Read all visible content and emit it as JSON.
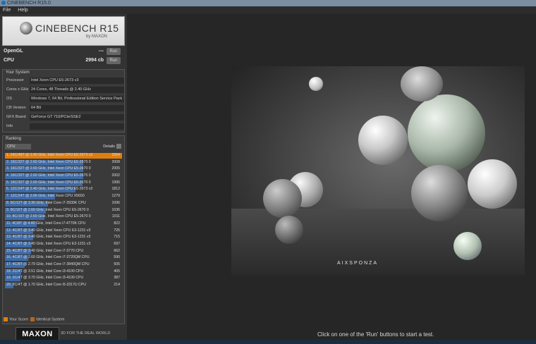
{
  "window": {
    "title": "CINEBENCH R15.0"
  },
  "menu": [
    "File",
    "Help"
  ],
  "logo": {
    "title": "CINEBENCH R15",
    "sub": "by MAXON"
  },
  "scores": {
    "opengl": {
      "label": "OpenGL",
      "value": "---",
      "run": "Run"
    },
    "cpu": {
      "label": "CPU",
      "value": "2994 cb",
      "run": "Run"
    }
  },
  "system": {
    "title": "Your System",
    "rows": [
      {
        "k": "Processor",
        "v": "Intel Xeon CPU E5-2673 v3"
      },
      {
        "k": "Cores x GHz",
        "v": "24 Cores, 48 Threads @ 2.40 GHz"
      },
      {
        "k": "OS",
        "v": "Windows 7, 64 Bit, Professional Edition Service Pack 1"
      },
      {
        "k": "CB Version",
        "v": "64 Bit"
      },
      {
        "k": "GFX Board",
        "v": "GeForce GT 710/PCIe/SSE2"
      },
      {
        "k": "Info",
        "v": ""
      }
    ]
  },
  "ranking": {
    "title": "Ranking",
    "select": "CPU",
    "details": "Details",
    "rows": [
      {
        "label": "1. 24C/48T @ 2.40 GHz, Intel Xeon CPU E5-2673 v3",
        "score": "2994",
        "pct": 1.0
      },
      {
        "label": "2. 16C/32T @ 2.60 GHz, Intel Xeon CPU E5-2670 0",
        "score": "2008",
        "pct": 0.67
      },
      {
        "label": "3. 16C/32T @ 2.60 GHz, Intel Xeon CPU E5-2670 0",
        "score": "2005",
        "pct": 0.67
      },
      {
        "label": "4. 16C/32T @ 2.60 GHz, Intel Xeon CPU E5-2670 0",
        "score": "2002",
        "pct": 0.67
      },
      {
        "label": "5. 16C/32T @ 2.60 GHz, Intel Xeon CPU E5-2670 0",
        "score": "1995",
        "pct": 0.66
      },
      {
        "label": "6. 12C/24T @ 2.40 GHz, Intel Xeon CPU E5-2673 v3",
        "score": "1812",
        "pct": 0.6
      },
      {
        "label": "7. 12C/24T @ 2.66 GHz, Intel Xeon CPU X5650",
        "score": "1279",
        "pct": 0.43
      },
      {
        "label": "8. 6C/12T @ 3.30 GHz, Intel Core i7-3930K CPU",
        "score": "1096",
        "pct": 0.37
      },
      {
        "label": "9. 8C/16T @ 2.60 GHz, Intel Xeon CPU E5-2670 0",
        "score": "1036",
        "pct": 0.35
      },
      {
        "label": "10. 8C/16T @ 2.60 GHz, Intel Xeon CPU E5-2670 0",
        "score": "1011",
        "pct": 0.34
      },
      {
        "label": "11. 4C/8T @ 4.40 GHz, Intel Core i7-4770K CPU",
        "score": "822",
        "pct": 0.27
      },
      {
        "label": "12. 4C/8T @ 3.40 GHz, Intel Xeon CPU E3-1231 v3",
        "score": "725",
        "pct": 0.24
      },
      {
        "label": "13. 4C/8T @ 3.40 GHz, Intel Xeon CPU E3-1231 v3",
        "score": "715",
        "pct": 0.24
      },
      {
        "label": "14. 4C/8T @ 3.40 GHz, Intel Xeon CPU E3-1231 v3",
        "score": "697",
        "pct": 0.23
      },
      {
        "label": "15. 4C/8T @ 3.40 GHz, Intel Core i7-3770 CPU",
        "score": "662",
        "pct": 0.22
      },
      {
        "label": "16. 4C/8T @ 2.60 GHz, Intel Core i7-3720QM CPU",
        "score": "590",
        "pct": 0.2
      },
      {
        "label": "17. 4C/8T @ 2.79 GHz, Intel Core i7-3840QM CPU",
        "score": "505",
        "pct": 0.17
      },
      {
        "label": "18. 2C/4T @ 3.51 GHz, Intel Core i3-4100 CPU",
        "score": "405",
        "pct": 0.14
      },
      {
        "label": "19. 2C/4T @ 3.70 GHz, Intel Core i3-4100 CPU",
        "score": "387",
        "pct": 0.13
      },
      {
        "label": "20. 2C/4T @ 1.70 GHz, Intel Core i5-3317U CPU",
        "score": "214",
        "pct": 0.07
      }
    ]
  },
  "legend": {
    "your_score": "Your Score",
    "identical": "Identical System",
    "your_color": "#e07d10",
    "identical_color": "#b8651a"
  },
  "footer": {
    "brand": "MAXON",
    "tagline": "3D FOR THE REAL WORLD"
  },
  "render": {
    "watermark": "AIXSPONZA"
  },
  "status": "Click on one of the 'Run' buttons to start a test."
}
